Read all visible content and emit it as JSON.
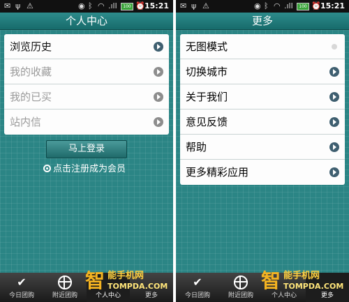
{
  "status_bar": {
    "time": "15:21",
    "battery": "100",
    "signal": ".ıll"
  },
  "left_screen": {
    "title": "个人中心",
    "menu": [
      {
        "label": "浏览历史",
        "state": "active"
      },
      {
        "label": "我的收藏",
        "state": "dim"
      },
      {
        "label": "我的已买",
        "state": "dim"
      },
      {
        "label": "站内信",
        "state": "dim"
      }
    ],
    "login_button": "马上登录",
    "register_link": "点击注册成为会员"
  },
  "right_screen": {
    "title": "更多",
    "menu": [
      {
        "label": "无图模式"
      },
      {
        "label": "切换城市"
      },
      {
        "label": "关于我们"
      },
      {
        "label": "意见反馈"
      },
      {
        "label": "帮助"
      },
      {
        "label": "更多精彩应用"
      }
    ]
  },
  "tabs": [
    "今日团购",
    "附近团购",
    "个人中心",
    "更多"
  ],
  "watermark": {
    "brand": "能手机网",
    "url": "TOMPDA.COM",
    "glyph": "智"
  },
  "colors": {
    "accent": "#2b8585",
    "title_bar": "#176b6b",
    "arrow": "#3f5f70",
    "watermark": "#f4b321"
  }
}
